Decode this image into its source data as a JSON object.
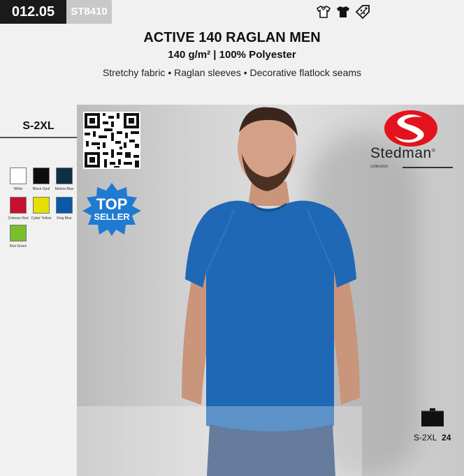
{
  "header": {
    "code": "012.05",
    "sku": "ST8410",
    "icons": [
      "tshirt-outline-icon",
      "tshirt-solid-icon",
      "discount-tag-icon"
    ]
  },
  "product": {
    "title": "ACTIVE 140 RAGLAN MEN",
    "spec": "140 g/m² | 100% Polyester",
    "features": "Stretchy fabric • Raglan sleeves • Decorative flatlock seams"
  },
  "sizes": {
    "range": "S-2XL"
  },
  "colors": [
    {
      "name": "White",
      "hex": "#ffffff"
    },
    {
      "name": "Black Opal",
      "hex": "#0d0d0d"
    },
    {
      "name": "Marina Blue",
      "hex": "#0f2f45"
    },
    {
      "name": "Crimson Red",
      "hex": "#c8102e"
    },
    {
      "name": "Cyber Yellow",
      "hex": "#e6e000"
    },
    {
      "name": "King Blue",
      "hex": "#0a58a6"
    },
    {
      "name": "Kiwi Green",
      "hex": "#79be2b"
    }
  ],
  "badge": {
    "line1": "TOP",
    "line2": "SELLER",
    "color": "#1f7bd1"
  },
  "brand": {
    "name": "Stedman",
    "registered": "®",
    "sub": "collection",
    "accent": "#e3121c"
  },
  "packaging": {
    "sizes": "S-2XL",
    "quantity": "24"
  }
}
